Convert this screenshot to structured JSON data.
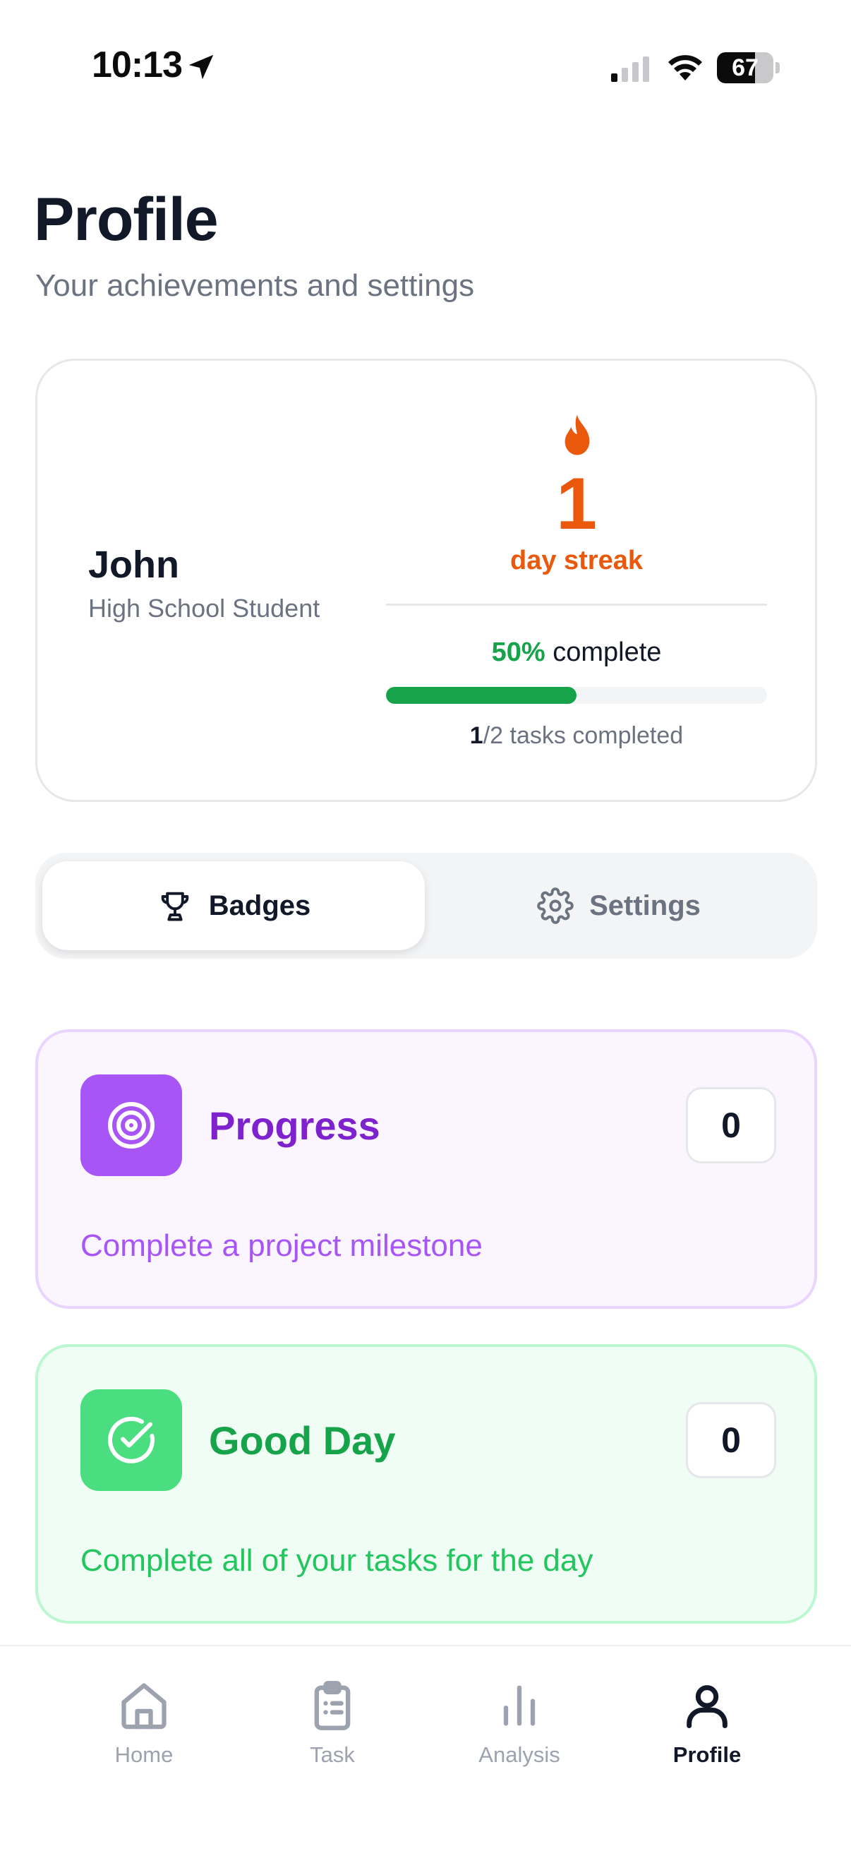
{
  "status_bar": {
    "time": "10:13",
    "battery_level": 67,
    "battery_text": "67"
  },
  "header": {
    "title": "Profile",
    "subtitle": "Your achievements and settings"
  },
  "profile": {
    "name": "John",
    "role": "High School Student",
    "streak_count": "1",
    "streak_label": "day streak",
    "completion_percent_text": "50%",
    "completion_suffix": "complete",
    "progress_fraction": 0.5,
    "tasks_done": "1",
    "tasks_total": "/2",
    "tasks_suffix": "tasks completed"
  },
  "tabs": [
    {
      "label": "Badges",
      "icon": "trophy-icon",
      "active": true
    },
    {
      "label": "Settings",
      "icon": "gear-icon",
      "active": false
    }
  ],
  "badges": [
    {
      "title": "Progress",
      "count": "0",
      "description": "Complete a project milestone",
      "icon": "target-icon",
      "color": "#a855f7"
    },
    {
      "title": "Good Day",
      "count": "0",
      "description": "Complete all of your tasks for the day",
      "icon": "check-circle-icon",
      "color": "#4ade80"
    }
  ],
  "bottom_nav": [
    {
      "label": "Home",
      "icon": "home-icon",
      "active": false
    },
    {
      "label": "Task",
      "icon": "clipboard-icon",
      "active": false
    },
    {
      "label": "Analysis",
      "icon": "bar-chart-icon",
      "active": false
    },
    {
      "label": "Profile",
      "icon": "user-icon",
      "active": true
    }
  ],
  "colors": {
    "streak": "#ea580c",
    "success": "#16a34a",
    "purple": "#7e22ce"
  }
}
